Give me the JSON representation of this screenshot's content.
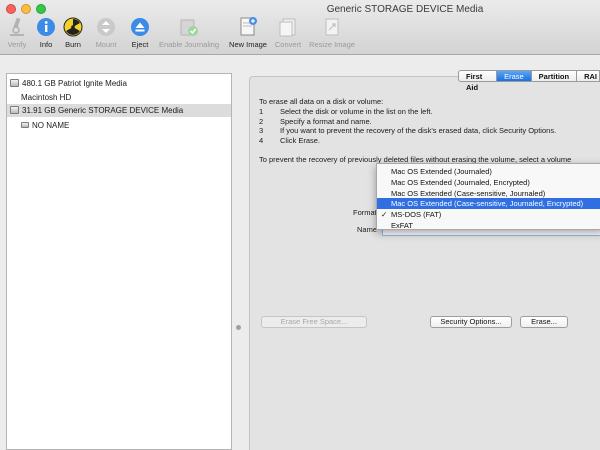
{
  "window": {
    "title": "Generic STORAGE DEVICE Media"
  },
  "toolbar": {
    "buttons": [
      {
        "label": "Verify",
        "icon": "microscope-icon",
        "enabled": false
      },
      {
        "label": "Info",
        "icon": "info-icon",
        "enabled": true
      },
      {
        "label": "Burn",
        "icon": "burn-radiation-icon",
        "enabled": true
      },
      {
        "label": "Mount",
        "icon": "mount-arrows-icon",
        "enabled": false
      },
      {
        "label": "Eject",
        "icon": "eject-icon",
        "enabled": true
      },
      {
        "label": "Enable Journaling",
        "icon": "journal-check-icon",
        "enabled": false
      },
      {
        "label": "New Image",
        "icon": "new-image-icon",
        "enabled": true
      },
      {
        "label": "Convert",
        "icon": "convert-icon",
        "enabled": false
      },
      {
        "label": "Resize Image",
        "icon": "resize-image-icon",
        "enabled": false
      }
    ]
  },
  "sidebar": {
    "items": [
      {
        "label": "480.1 GB Patriot Ignite Media",
        "level": 0,
        "selected": false
      },
      {
        "label": "Macintosh HD",
        "level": 1,
        "selected": false
      },
      {
        "label": "31.91 GB Generic STORAGE DEVICE Media",
        "level": 0,
        "selected": true
      },
      {
        "label": "NO NAME",
        "level": 1,
        "selected": false
      }
    ]
  },
  "tabs": [
    {
      "label": "First Aid",
      "active": false
    },
    {
      "label": "Erase",
      "active": true
    },
    {
      "label": "Partition",
      "active": false
    },
    {
      "label": "RAI",
      "active": false
    }
  ],
  "erase": {
    "intro": "To erase all data on a disk or volume:",
    "steps": [
      {
        "num": "1",
        "text": "Select the disk or volume in the list on the left."
      },
      {
        "num": "2",
        "text": "Specify a format and name."
      },
      {
        "num": "3",
        "text": "If you want to prevent the recovery of the disk's erased data, click Security Options."
      },
      {
        "num": "4",
        "text": "Click Erase."
      }
    ],
    "prevent_note": "To prevent the recovery of previously deleted files without erasing the volume, select a volume",
    "format_label": "Format",
    "name_label": "Name",
    "name_value": "",
    "erase_free_space_button": "Erase Free Space...",
    "security_options_button": "Security Options...",
    "erase_button": "Erase..."
  },
  "format_menu": {
    "options": [
      {
        "label": "Mac OS Extended (Journaled)",
        "highlighted": false,
        "checked": false
      },
      {
        "label": "Mac OS Extended (Journaled, Encrypted)",
        "highlighted": false,
        "checked": false
      },
      {
        "label": "Mac OS Extended (Case-sensitive, Journaled)",
        "highlighted": false,
        "checked": false
      },
      {
        "label": "Mac OS Extended (Case-sensitive, Journaled, Encrypted)",
        "highlighted": true,
        "checked": false
      },
      {
        "label": "MS-DOS (FAT)",
        "highlighted": false,
        "checked": true
      },
      {
        "label": "ExFAT",
        "highlighted": false,
        "checked": false
      }
    ],
    "check_glyph": "✓"
  },
  "colors": {
    "accent": "#2f6fe1",
    "tab_active": "#1b6fe0",
    "close": "#fc605c",
    "minimize": "#fdbc40",
    "zoom": "#34c84a"
  }
}
